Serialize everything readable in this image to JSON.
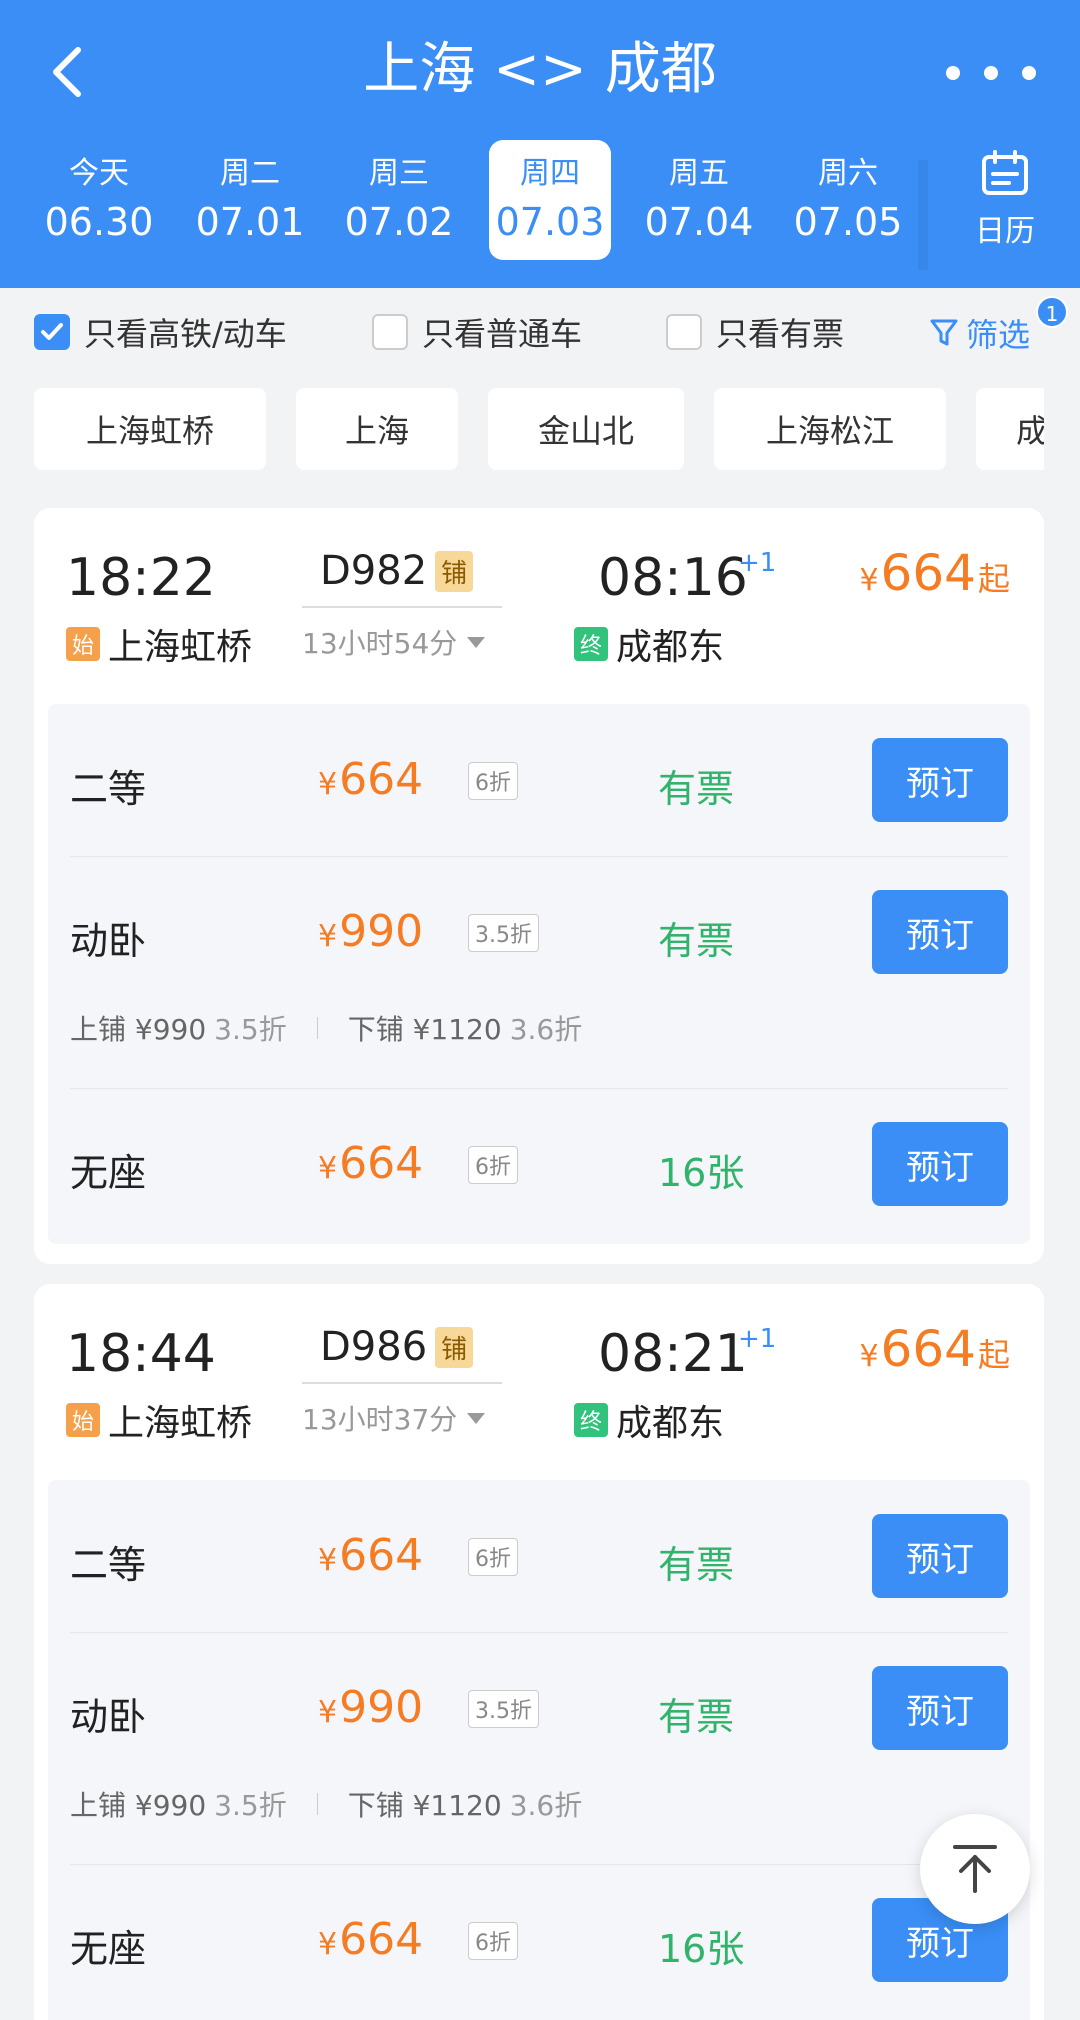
{
  "header": {
    "title": "上海 <> 成都",
    "calendar_label": "日历"
  },
  "dates": [
    {
      "weekday": "今天",
      "date": "06.30"
    },
    {
      "weekday": "周二",
      "date": "07.01"
    },
    {
      "weekday": "周三",
      "date": "07.02"
    },
    {
      "weekday": "周四",
      "date": "07.03"
    },
    {
      "weekday": "周五",
      "date": "07.04"
    },
    {
      "weekday": "周六",
      "date": "07.05"
    }
  ],
  "filters": {
    "highspeed": "只看高铁/动车",
    "normal": "只看普通车",
    "has_ticket": "只看有票",
    "filter_label": "筛选",
    "filter_badge": "1"
  },
  "stations": [
    "上海虹桥",
    "上海",
    "金山北",
    "上海松江",
    "成"
  ],
  "trains": [
    {
      "dep_time": "18:22",
      "arr_time": "08:16",
      "plus_day": "+1",
      "train_no": "D982",
      "sleeper_tag": "铺",
      "duration": "13小时54分",
      "start_tag": "始",
      "end_tag": "终",
      "dep_station": "上海虹桥",
      "arr_station": "成都东",
      "min_price": "664",
      "from_suffix": "起",
      "seats": [
        {
          "class": "二等",
          "price": "664",
          "discount": "6折",
          "availability": "有票",
          "book": "预订"
        },
        {
          "class": "动卧",
          "price": "990",
          "discount": "3.5折",
          "availability": "有票",
          "book": "预订",
          "upper": "上铺 ¥990",
          "upper_disc": "3.5折",
          "lower": "下铺 ¥1120",
          "lower_disc": "3.6折"
        },
        {
          "class": "无座",
          "price": "664",
          "discount": "6折",
          "availability": "16张",
          "book": "预订"
        }
      ]
    },
    {
      "dep_time": "18:44",
      "arr_time": "08:21",
      "plus_day": "+1",
      "train_no": "D986",
      "sleeper_tag": "铺",
      "duration": "13小时37分",
      "start_tag": "始",
      "end_tag": "终",
      "dep_station": "上海虹桥",
      "arr_station": "成都东",
      "min_price": "664",
      "from_suffix": "起",
      "seats": [
        {
          "class": "二等",
          "price": "664",
          "discount": "6折",
          "availability": "有票",
          "book": "预订"
        },
        {
          "class": "动卧",
          "price": "990",
          "discount": "3.5折",
          "availability": "有票",
          "book": "预订",
          "upper": "上铺 ¥990",
          "upper_disc": "3.5折",
          "lower": "下铺 ¥1120",
          "lower_disc": "3.6折"
        },
        {
          "class": "无座",
          "price": "664",
          "discount": "6折",
          "availability": "16张",
          "book": "预订"
        }
      ]
    }
  ],
  "currency": "¥",
  "colors": {
    "brand": "#3a8ef6",
    "price": "#f57c22",
    "available": "#31b36b"
  }
}
